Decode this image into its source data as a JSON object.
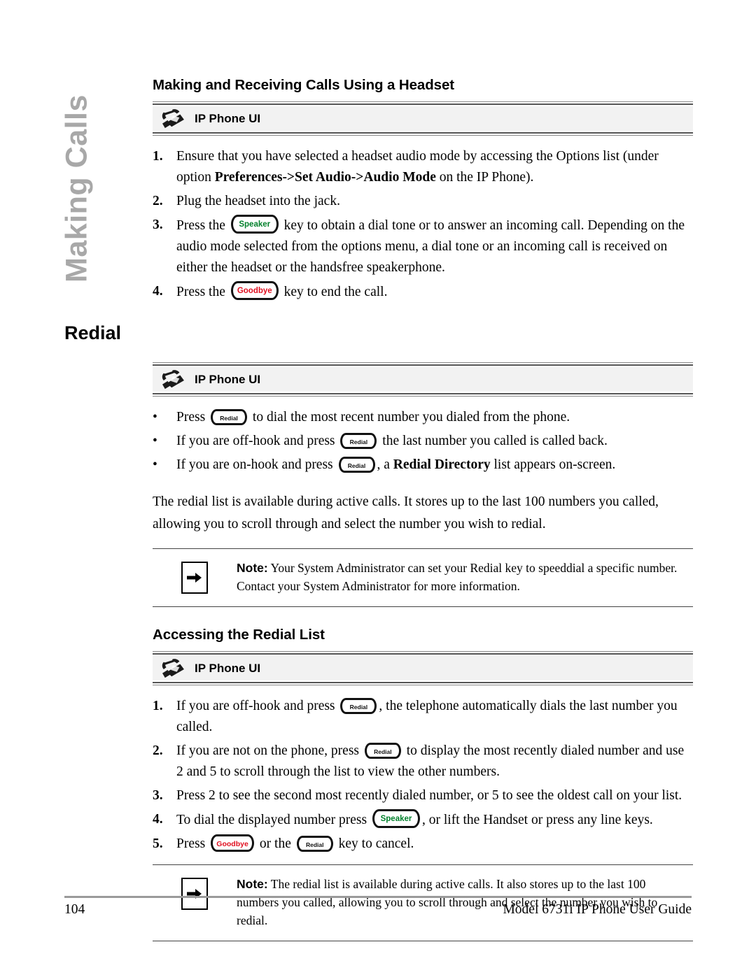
{
  "sidebar": {
    "tab_label": "Making Calls"
  },
  "section_headset": {
    "heading": "Making and Receiving Calls Using a Headset",
    "ui_bar_label": "IP Phone UI",
    "steps": [
      {
        "num": "1.",
        "part1": "Ensure that you have selected a headset audio mode by accessing the Options list (under option ",
        "bold": "Preferences->Set Audio->Audio Mode",
        "part2": " on the IP Phone)."
      },
      {
        "num": "2.",
        "part1": "Plug the headset into the jack."
      },
      {
        "num": "3.",
        "part1": "Press the ",
        "key": "Speaker",
        "part2": " key to obtain a dial tone or to answer an incoming call. Depending on the audio mode selected from the options menu, a dial tone or an incoming call is received on either the headset or the handsfree speakerphone."
      },
      {
        "num": "4.",
        "part1": "Press the ",
        "key": "Goodbye",
        "part2": " key to end the call."
      }
    ]
  },
  "section_redial": {
    "heading": "Redial",
    "ui_bar_label": "IP Phone UI",
    "bullets": [
      {
        "mark": "•",
        "part1": "Press ",
        "key": "Redial",
        "part2": " to dial the most recent number you dialed from the phone."
      },
      {
        "mark": "•",
        "part1": "If you are off-hook and press ",
        "key": "Redial",
        "part2": " the last number you called is called back."
      },
      {
        "mark": "•",
        "part1": "If you are on-hook and press ",
        "key": "Redial",
        "part2": ", a ",
        "bold": "Redial Directory",
        "part3": " list appears on-screen."
      }
    ],
    "paragraph": "The redial list is available during active calls. It stores up to the last 100 numbers you called, allowing you to scroll through and select the number you wish to redial.",
    "note": {
      "lead": "Note:",
      "text": " Your System Administrator can set your Redial key to speeddial a specific number. Contact your System Administrator for more information.",
      "icon": "arrow-right-icon"
    }
  },
  "section_accessing": {
    "heading": "Accessing the Redial List",
    "ui_bar_label": "IP Phone UI",
    "steps": [
      {
        "num": "1.",
        "part1": "If you are off-hook and press ",
        "key": "Redial",
        "part2": ", the telephone automatically dials the last number you called."
      },
      {
        "num": "2.",
        "part1": "If you are not on the phone, press ",
        "key": "Redial",
        "part2": " to display the most recently dialed number and use 2 and 5 to scroll through the list to view the other numbers."
      },
      {
        "num": "3.",
        "part1": "Press 2 to see the second most recently dialed number, or 5 to see the oldest call on your list."
      },
      {
        "num": "4.",
        "part1": "To dial the displayed number press ",
        "key": "Speaker",
        "part2": ", or lift the Handset or press any line keys."
      },
      {
        "num": "5.",
        "part1": "Press ",
        "key": "Goodbye",
        "part2": " or the ",
        "key2": "Redial",
        "part3": " key to cancel."
      }
    ],
    "note": {
      "lead": "Note:",
      "text": " The redial list is available during active calls. It also stores up to the last 100 numbers you called, allowing you to scroll through and select the number you wish to redial.",
      "icon": "arrow-right-icon"
    }
  },
  "footer": {
    "page_number": "104",
    "guide_title": "Model 6731i IP Phone User Guide"
  },
  "colors": {
    "speaker_key_text": "#00802b",
    "goodbye_key_text": "#e01020",
    "redial_key_text": "#111111",
    "side_tab": "#a8a8a8",
    "ui_bar_bg": "#f2f2f2"
  }
}
